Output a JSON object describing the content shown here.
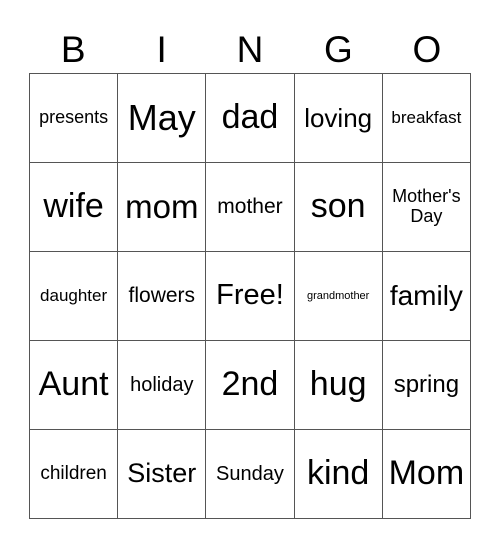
{
  "header": [
    "B",
    "I",
    "N",
    "G",
    "O"
  ],
  "rows": [
    [
      {
        "t": "presents",
        "s": 18
      },
      {
        "t": "May",
        "s": 36
      },
      {
        "t": "dad",
        "s": 34
      },
      {
        "t": "loving",
        "s": 26
      },
      {
        "t": "breakfast",
        "s": 17
      }
    ],
    [
      {
        "t": "wife",
        "s": 34
      },
      {
        "t": "mom",
        "s": 33
      },
      {
        "t": "mother",
        "s": 21
      },
      {
        "t": "son",
        "s": 34
      },
      {
        "t": "Mother's Day",
        "s": 18
      }
    ],
    [
      {
        "t": "daughter",
        "s": 17
      },
      {
        "t": "flowers",
        "s": 21
      },
      {
        "t": "Free!",
        "s": 29
      },
      {
        "t": "grandmother",
        "s": 11
      },
      {
        "t": "family",
        "s": 28
      }
    ],
    [
      {
        "t": "Aunt",
        "s": 34
      },
      {
        "t": "holiday",
        "s": 20
      },
      {
        "t": "2nd",
        "s": 34
      },
      {
        "t": "hug",
        "s": 34
      },
      {
        "t": "spring",
        "s": 24
      }
    ],
    [
      {
        "t": "children",
        "s": 19
      },
      {
        "t": "Sister",
        "s": 27
      },
      {
        "t": "Sunday",
        "s": 20
      },
      {
        "t": "kind",
        "s": 34
      },
      {
        "t": "Mom",
        "s": 34
      }
    ]
  ]
}
